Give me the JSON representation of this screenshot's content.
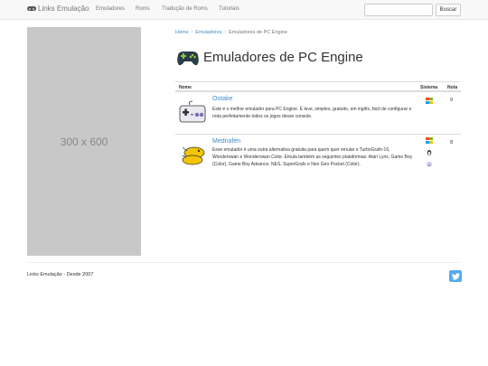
{
  "navbar": {
    "brand": "Links Emulação",
    "items": [
      "Emuladores",
      "Roms",
      "Tradução de Roms",
      "Tutoriais"
    ],
    "search_placeholder": "",
    "search_button": "Buscar"
  },
  "ad": {
    "label": "300 x 600"
  },
  "breadcrumb": {
    "home": "Home",
    "section": "Emuladores",
    "current": "Emuladores de PC Engine"
  },
  "page": {
    "title": "Emuladores de PC Engine"
  },
  "table": {
    "headers": {
      "name": "Nome",
      "system": "Sistema",
      "rating": "Nota"
    },
    "rows": [
      {
        "name": "Ootake",
        "description": "Este é o melhor emulador para PC Engine. É leve, simples, gratuito, em inglês, fácil de configurar e roda perfeitamente todos os jogos desse console.",
        "systems": [
          "windows-icon"
        ],
        "rating": "9"
      },
      {
        "name": "Mednafen",
        "description": "Esse emulador é uma outra alternativa gratuita para quem quer emular o TurboGrafx-16, Wonderswan e Wonderswan Color. Emula também as seguintes plataformas: Atari Lynx, Game Boy (Color), Game Boy Advance, NES, SuperGrafx e Neo Geo Pocket (Color).",
        "systems": [
          "windows-icon",
          "linux-icon",
          "freebsd-icon"
        ],
        "rating": "8"
      }
    ]
  },
  "footer": {
    "text": "Links Emulação - Desde 2007",
    "social": "twitter-icon"
  },
  "colors": {
    "link": "#428bca",
    "navbar_bg": "#f8f8f8",
    "ad_bg": "#c8c8c8",
    "twitter": "#55acee"
  }
}
